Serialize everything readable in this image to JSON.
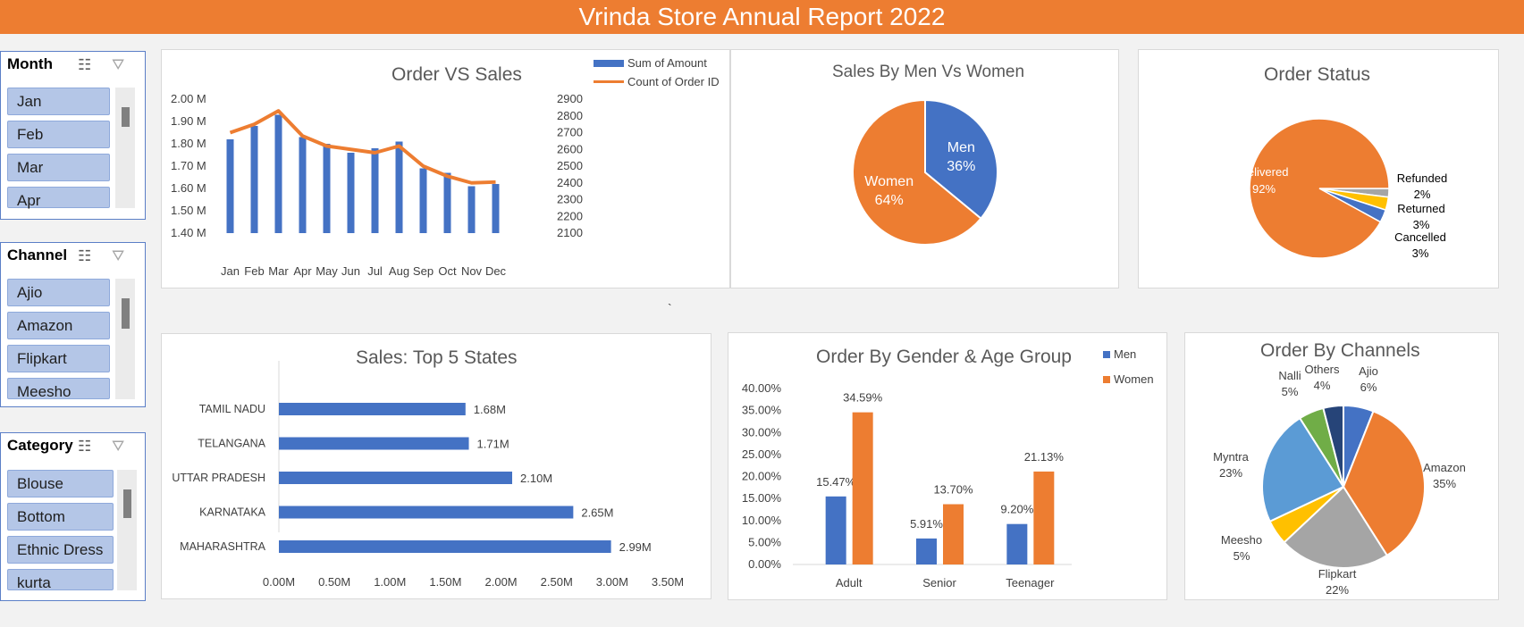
{
  "page_title": "Vrinda Store Annual Report 2022",
  "slicers": [
    {
      "title": "Month",
      "items": [
        "Jan",
        "Feb",
        "Mar",
        "Apr"
      ]
    },
    {
      "title": "Channel",
      "items": [
        "Ajio",
        "Amazon",
        "Flipkart",
        "Meesho"
      ]
    },
    {
      "title": "Category",
      "items": [
        "Blouse",
        "Bottom",
        "Ethnic Dress",
        "kurta"
      ]
    }
  ],
  "stray_mark": "`",
  "chart_data": [
    {
      "type": "bar+line",
      "title": "Order VS Sales",
      "categories": [
        "Jan",
        "Feb",
        "Mar",
        "Apr",
        "May",
        "Jun",
        "Jul",
        "Aug",
        "Sep",
        "Oct",
        "Nov",
        "Dec"
      ],
      "series": [
        {
          "name": "Sum of Amount",
          "type": "bar",
          "axis": "left",
          "color": "#4472c4",
          "values": [
            1.82,
            1.88,
            1.93,
            1.83,
            1.8,
            1.76,
            1.78,
            1.81,
            1.69,
            1.67,
            1.61,
            1.62
          ]
        },
        {
          "name": "Count of Order ID",
          "type": "line",
          "axis": "right",
          "color": "#ed7d31",
          "values": [
            2700,
            2750,
            2830,
            2680,
            2620,
            2600,
            2580,
            2620,
            2500,
            2440,
            2400,
            2405
          ]
        }
      ],
      "y_left_ticks": [
        "2.00 M",
        "1.90 M",
        "1.80 M",
        "1.70 M",
        "1.60 M",
        "1.50 M",
        "1.40 M"
      ],
      "y_left_range": [
        1.4,
        2.0
      ],
      "y_right_ticks": [
        "2900",
        "2800",
        "2700",
        "2600",
        "2500",
        "2400",
        "2300",
        "2200",
        "2100"
      ],
      "y_right_range": [
        2100,
        2900
      ],
      "legend": "top-right"
    },
    {
      "type": "pie",
      "title": "Sales By Men Vs Women",
      "slices": [
        {
          "label": "Men",
          "value": 36,
          "text": "36%",
          "color": "#4472c4"
        },
        {
          "label": "Women",
          "value": 64,
          "text": "64%",
          "color": "#ed7d31"
        }
      ]
    },
    {
      "type": "pie",
      "title": "Order Status",
      "slices": [
        {
          "label": "Delivered",
          "value": 92,
          "text": "92%",
          "color": "#ed7d31"
        },
        {
          "label": "Refunded",
          "value": 2,
          "text": "2%",
          "color": "#a5a5a5"
        },
        {
          "label": "Returned",
          "value": 3,
          "text": "3%",
          "color": "#ffc000"
        },
        {
          "label": "Cancelled",
          "value": 3,
          "text": "3%",
          "color": "#4472c4"
        }
      ]
    },
    {
      "type": "bar",
      "orientation": "horizontal",
      "title": "Sales: Top 5 States",
      "categories": [
        "TAMIL NADU",
        "TELANGANA",
        "UTTAR PRADESH",
        "KARNATAKA",
        "MAHARASHTRA"
      ],
      "values": [
        1.68,
        1.71,
        2.1,
        2.65,
        2.99
      ],
      "labels": [
        "1.68M",
        "1.71M",
        "2.10M",
        "2.65M",
        "2.99M"
      ],
      "x_ticks": [
        "0.00M",
        "0.50M",
        "1.00M",
        "1.50M",
        "2.00M",
        "2.50M",
        "3.00M",
        "3.50M"
      ],
      "xlim": [
        0,
        3.5
      ],
      "color": "#4472c4"
    },
    {
      "type": "bar",
      "title": "Order By Gender & Age Group",
      "categories": [
        "Adult",
        "Senior",
        "Teenager"
      ],
      "series": [
        {
          "name": "Men",
          "color": "#4472c4",
          "values": [
            15.47,
            5.91,
            9.2
          ],
          "labels": [
            "15.47%",
            "5.91%",
            "9.20%"
          ]
        },
        {
          "name": "Women",
          "color": "#ed7d31",
          "values": [
            34.59,
            13.7,
            21.13
          ],
          "labels": [
            "34.59%",
            "13.70%",
            "21.13%"
          ]
        }
      ],
      "y_ticks": [
        "40.00%",
        "35.00%",
        "30.00%",
        "25.00%",
        "20.00%",
        "15.00%",
        "10.00%",
        "5.00%",
        "0.00%"
      ],
      "ylim": [
        0,
        40
      ],
      "legend": "top-right"
    },
    {
      "type": "pie",
      "title": "Order By Channels",
      "slices": [
        {
          "label": "Ajio",
          "value": 6,
          "text": "6%",
          "color": "#4472c4"
        },
        {
          "label": "Amazon",
          "value": 35,
          "text": "35%",
          "color": "#ed7d31"
        },
        {
          "label": "Flipkart",
          "value": 22,
          "text": "22%",
          "color": "#a5a5a5"
        },
        {
          "label": "Meesho",
          "value": 5,
          "text": "5%",
          "color": "#ffc000"
        },
        {
          "label": "Myntra",
          "value": 23,
          "text": "23%",
          "color": "#5b9bd5"
        },
        {
          "label": "Nalli",
          "value": 5,
          "text": "5%",
          "color": "#70ad47"
        },
        {
          "label": "Others",
          "value": 4,
          "text": "4%",
          "color": "#264478"
        }
      ]
    }
  ]
}
